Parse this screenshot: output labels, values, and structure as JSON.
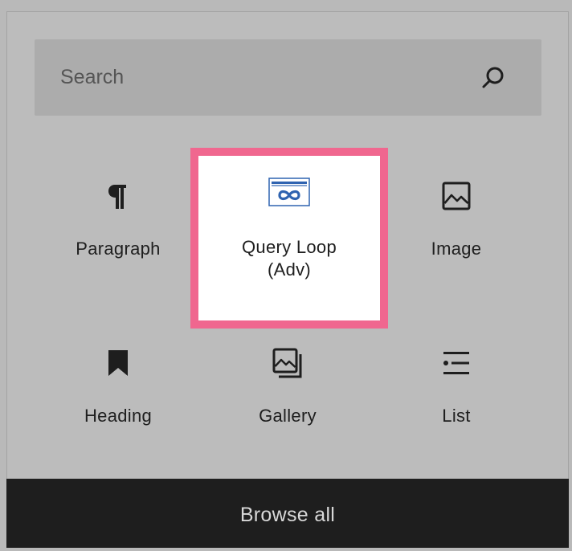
{
  "search": {
    "placeholder": "Search",
    "icon": "search-icon"
  },
  "blocks": [
    {
      "label": "Paragraph",
      "icon": "paragraph-icon"
    },
    {
      "label": "Query Loop (Adv)",
      "icon": "query-loop-icon",
      "highlighted": true
    },
    {
      "label": "Image",
      "icon": "image-icon"
    },
    {
      "label": "Heading",
      "icon": "bookmark-icon"
    },
    {
      "label": "Gallery",
      "icon": "gallery-icon"
    },
    {
      "label": "List",
      "icon": "list-icon"
    }
  ],
  "footer": {
    "browse_label": "Browse all"
  },
  "colors": {
    "highlight_border": "#f0678f",
    "footer_bg": "#1e1e1e",
    "query_loop_icon": "#2f63b0"
  }
}
